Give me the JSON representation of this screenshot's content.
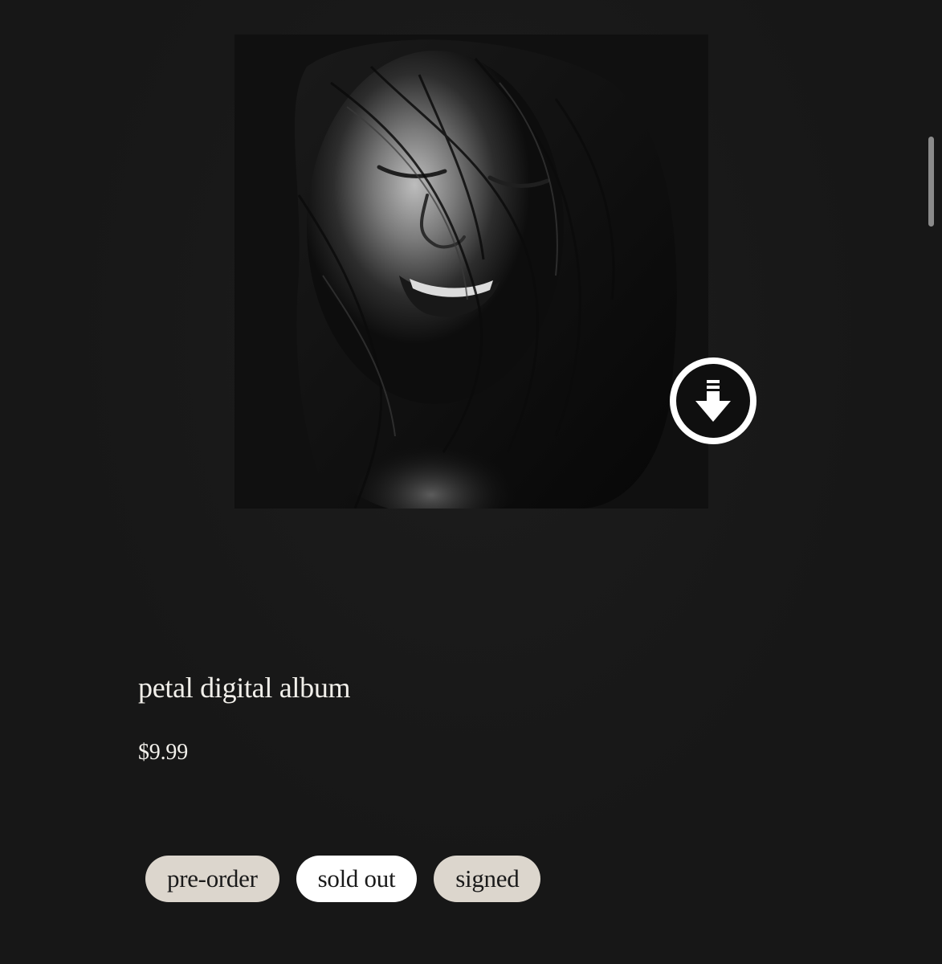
{
  "product": {
    "title": "petal digital album",
    "price": "$9.99"
  },
  "tags": [
    {
      "label": "pre-order",
      "selected": false
    },
    {
      "label": "sold out",
      "selected": true
    },
    {
      "label": "signed",
      "selected": false
    }
  ],
  "icons": {
    "download": "download-arrow-icon"
  },
  "colors": {
    "background": "#171717",
    "text": "#f1efea",
    "tag_bg": "#dcd6cd",
    "tag_active_bg": "#ffffff"
  }
}
